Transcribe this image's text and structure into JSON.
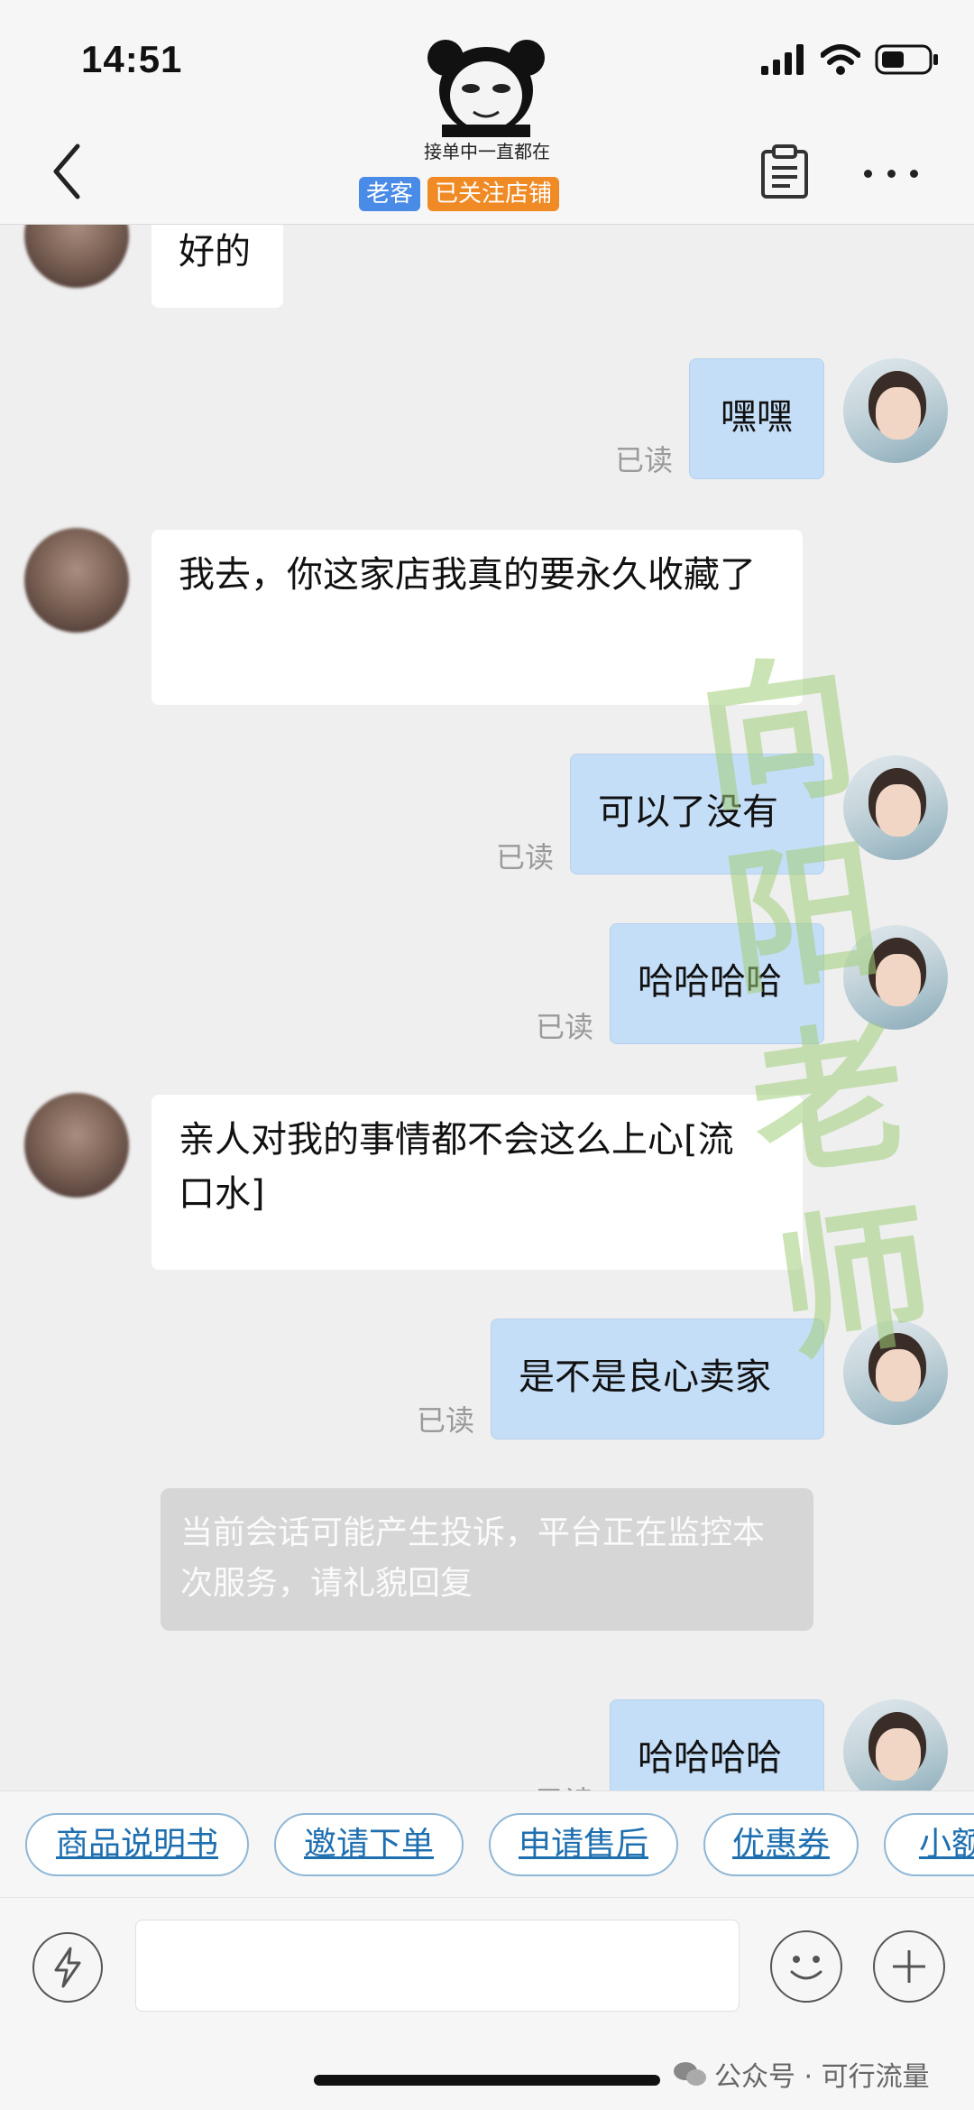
{
  "status_bar": {
    "time": "14:51"
  },
  "header": {
    "shop_subtitle": "接单中一直都在",
    "tags": [
      "老客",
      "已关注店铺"
    ]
  },
  "messages": [
    {
      "from": "peer",
      "text": "好的"
    },
    {
      "from": "self",
      "text": "嘿嘿",
      "status": "已读"
    },
    {
      "from": "peer",
      "text": "我去，你这家店我真的要永久收藏了"
    },
    {
      "from": "self",
      "text": "可以了没有",
      "status": "已读"
    },
    {
      "from": "self",
      "text": "哈哈哈哈",
      "status": "已读"
    },
    {
      "from": "peer",
      "text": "亲人对我的事情都不会这么上心[流口水]"
    },
    {
      "from": "self",
      "text": "是不是良心卖家",
      "status": "已读"
    },
    {
      "from": "self",
      "text": "哈哈哈哈",
      "status": "已读"
    }
  ],
  "system_notice": "当前会话可能产生投诉，平台正在监控本次服务，请礼貌回复",
  "watermark_text": [
    "向",
    "阳",
    "老",
    "师"
  ],
  "quick_chips": [
    "商品说明书",
    "邀请下单",
    "申请售后",
    "优惠券",
    "小额"
  ],
  "footer_credit": "公众号 · 可行流量",
  "colors": {
    "self_bubble": "#c5def7",
    "peer_bubble": "#ffffff",
    "tag_blue": "#4a8be8",
    "tag_orange": "#f08a24",
    "chip_text": "#1e6fb0"
  }
}
